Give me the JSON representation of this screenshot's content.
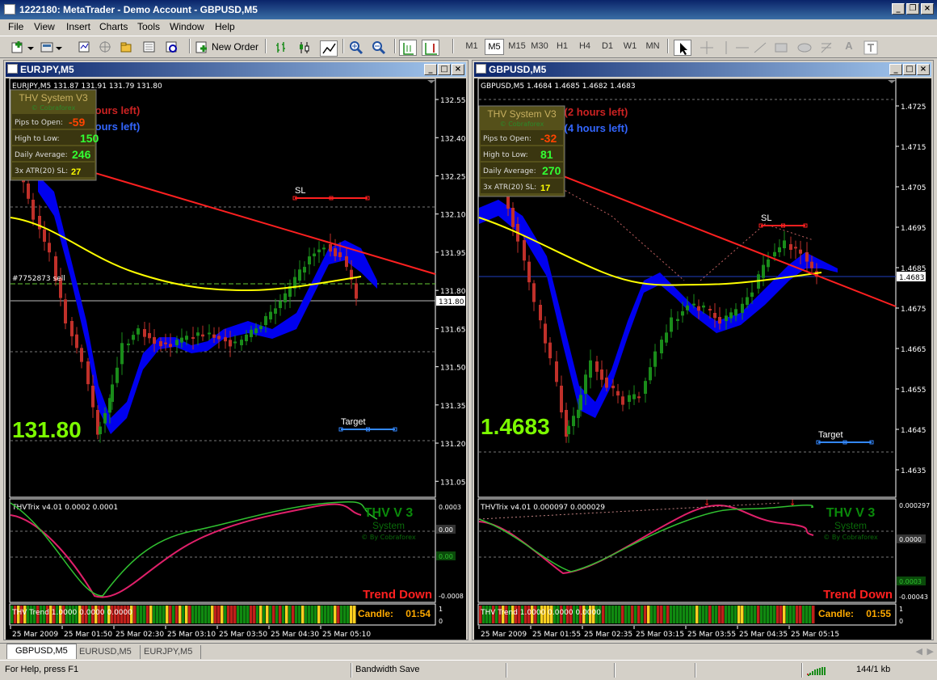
{
  "app": {
    "title": "1222180: MetaTrader - Demo Account - GBPUSD,M5",
    "menu": [
      "File",
      "View",
      "Insert",
      "Charts",
      "Tools",
      "Window",
      "Help"
    ],
    "new_order_label": "New Order",
    "timeframes": [
      "M1",
      "M5",
      "M15",
      "M30",
      "H1",
      "H4",
      "D1",
      "W1",
      "MN"
    ],
    "active_timeframe": "M5",
    "text_tool_label": "A"
  },
  "charts": [
    {
      "window_title": "EURJPY,M5",
      "info_line": "EURJPY,M5  131.87 131.91 131.79 131.80",
      "panel": {
        "title": "THV System V3",
        "subtitle": "© Cobraforex",
        "rows": [
          {
            "label": "Pips to Open:",
            "value": "-59",
            "color": "#ff4400"
          },
          {
            "label": "High to Low:",
            "value": "150",
            "color": "#33ff33"
          },
          {
            "label": "Daily Average:",
            "value": "246",
            "color": "#33ff33"
          },
          {
            "label": "3x ATR(20) SL:",
            "value": "27",
            "color": "#ffff00"
          }
        ]
      },
      "session_lines": [
        {
          "text": "n (3 hours left)",
          "color": "#cc2222"
        },
        {
          "text": "n (5 hours left)",
          "color": "#3366ff"
        }
      ],
      "big_price": "131.80",
      "sl_label": "SL",
      "target_label": "Target",
      "order_label": "#7752873 sell",
      "current_price_tag": "131.80",
      "y_ticks": [
        "132.55",
        "132.40",
        "132.25",
        "132.10",
        "131.95",
        "131.80",
        "131.65",
        "131.50",
        "131.35",
        "131.20",
        "131.05"
      ],
      "price_range": [
        131.0,
        132.62
      ],
      "indicator": {
        "header": "THVTrix v4.01 0.0002 0.0001",
        "logo": [
          "THV V 3",
          "System",
          "© By Cobraforex"
        ],
        "signal": "Trend Down",
        "ticks": [
          "0.0003",
          "0.00",
          "0.00",
          "-0.0008"
        ]
      },
      "trend": {
        "header": "THV Trend 1.0000 0.0000 0.0000",
        "candle_label": "Candle:",
        "candle_time": "01:54",
        "ticks": [
          "1",
          "0"
        ]
      },
      "time_labels": [
        "25 Mar 2009",
        "25 Mar 01:50",
        "25 Mar 02:30",
        "25 Mar 03:10",
        "25 Mar 03:50",
        "25 Mar 04:30",
        "25 Mar 05:10"
      ]
    },
    {
      "window_title": "GBPUSD,M5",
      "info_line": "GBPUSD,M5  1.4684 1.4685 1.4682 1.4683",
      "panel": {
        "title": "THV System V3",
        "subtitle": "© Cobraforex",
        "rows": [
          {
            "label": "Pips to Open:",
            "value": "-32",
            "color": "#ff4400"
          },
          {
            "label": "High to Low:",
            "value": "81",
            "color": "#33ff33"
          },
          {
            "label": "Daily Average:",
            "value": "270",
            "color": "#33ff33"
          },
          {
            "label": "3x ATR(20) SL:",
            "value": "17",
            "color": "#ffff00"
          }
        ]
      },
      "session_lines": [
        {
          "text": "n (2 hours left)",
          "color": "#cc2222"
        },
        {
          "text": "n (4 hours left)",
          "color": "#3366ff"
        }
      ],
      "big_price": "1.4683",
      "sl_label": "SL",
      "target_label": "Target",
      "order_label": "",
      "current_price_tag": "1.4683",
      "y_ticks": [
        "1.4725",
        "1.4715",
        "1.4705",
        "1.4695",
        "1.4685",
        "1.4675",
        "1.4665",
        "1.4655",
        "1.4645",
        "1.4635"
      ],
      "price_range": [
        1.4629,
        1.4731
      ],
      "indicator": {
        "header": "THVTrix v4.01 0.000097 0.000029",
        "logo": [
          "THV V 3",
          "System",
          "© By Cobraforex"
        ],
        "signal": "Trend Down",
        "ticks": [
          "0.000297",
          "0.0000",
          "0.0003",
          "-0.00043"
        ]
      },
      "trend": {
        "header": "THV Trend 1.0000 0.0000 0.0000",
        "candle_label": "Candle:",
        "candle_time": "01:55",
        "ticks": [
          "1",
          "0"
        ]
      },
      "time_labels": [
        "25 Mar 2009",
        "25 Mar 01:55",
        "25 Mar 02:35",
        "25 Mar 03:15",
        "25 Mar 03:55",
        "25 Mar 04:35",
        "25 Mar 05:15"
      ]
    }
  ],
  "tabs": [
    "GBPUSD,M5",
    "EURUSD,M5",
    "EURJPY,M5"
  ],
  "active_tab": "GBPUSD,M5",
  "status": {
    "help": "For Help, press F1",
    "bandwidth": "Bandwidth Save",
    "traffic": "144/1 kb"
  },
  "colors": {
    "bull": "#1a8c1a",
    "bear": "#c0302a",
    "ma": "#ffff00",
    "cloud": "#0000ee",
    "trendline": "#ff2020"
  }
}
